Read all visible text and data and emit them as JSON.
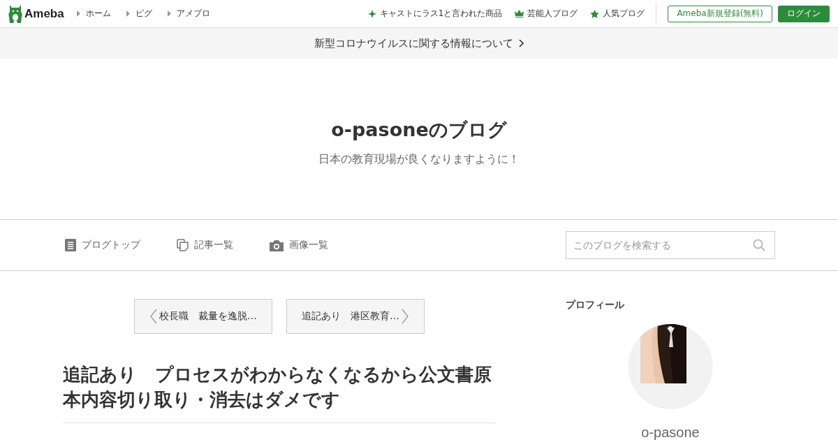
{
  "header": {
    "logo": "Ameba",
    "nav": [
      {
        "label": "ホーム"
      },
      {
        "label": "ピグ"
      },
      {
        "label": "アメブロ"
      }
    ],
    "links": [
      {
        "kind": "sparkle",
        "label": "キャストにラス1と言われた商品"
      },
      {
        "kind": "crown",
        "label": "芸能人ブログ"
      },
      {
        "kind": "star",
        "label": "人気ブログ"
      }
    ],
    "register": "Ameba新規登録(無料)",
    "login": "ログイン"
  },
  "notice": "新型コロナウイルスに関する情報について",
  "blog": {
    "title": "o-pasoneのブログ",
    "subtitle": "日本の教育現場が良くなりますように！"
  },
  "blog_nav": [
    {
      "kind": "doc",
      "label": "ブログトップ"
    },
    {
      "kind": "copy",
      "label": "記事一覧"
    },
    {
      "kind": "camera",
      "label": "画像一覧"
    }
  ],
  "search": {
    "placeholder": "このブログを検索する"
  },
  "pager": {
    "prev": "校長職　裁量を逸脱…",
    "next": "追記あり　港区教育…"
  },
  "article": {
    "title": "追記あり　プロセスがわからなくなるから公文書原本内容切り取り・消去はダメです"
  },
  "profile": {
    "heading": "プロフィール",
    "name": "o-pasone"
  }
}
